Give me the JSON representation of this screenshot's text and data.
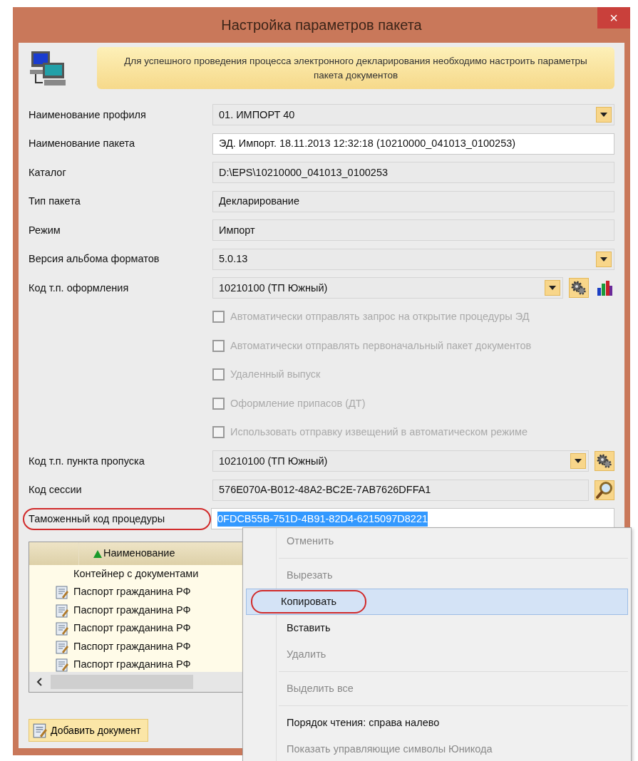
{
  "window": {
    "title": "Настройка параметров пакета",
    "close": "×"
  },
  "banner": {
    "text": "Для успешного проведения процесса электронного декларирования необходимо настроить параметры пакета документов"
  },
  "rows": [
    {
      "kind": "combo",
      "label": "Наименование профиля",
      "value": "01. ИМПОРТ 40",
      "readonly": true,
      "buttons": []
    },
    {
      "kind": "text",
      "label": "Наименование пакета",
      "value": "ЭД. Импорт. 18.11.2013 12:32:18 (10210000_041013_0100253)",
      "readonly": false,
      "buttons": []
    },
    {
      "kind": "text",
      "label": "Каталог",
      "value": "D:\\EPS\\10210000_041013_0100253",
      "readonly": true,
      "buttons": []
    },
    {
      "kind": "text",
      "label": "Тип пакета",
      "value": "Декларирование",
      "readonly": true,
      "buttons": []
    },
    {
      "kind": "text",
      "label": "Режим",
      "value": "Импорт",
      "readonly": true,
      "buttons": []
    },
    {
      "kind": "combo",
      "label": "Версия альбома форматов",
      "value": "5.0.13",
      "readonly": true,
      "buttons": []
    },
    {
      "kind": "combo",
      "label": "Код т.п. оформления",
      "value": "10210100 (ТП Южный)",
      "readonly": true,
      "buttons": [
        {
          "kind": "gear"
        },
        {
          "kind": "chart"
        }
      ]
    },
    {
      "kind": "checkbox",
      "label": "Автоматически отправлять запрос на открытие процедуры ЭД",
      "checked": false,
      "disabled": true
    },
    {
      "kind": "checkbox",
      "label": "Автоматически отправлять первоначальный пакет документов",
      "checked": false,
      "disabled": true
    },
    {
      "kind": "checkbox",
      "label": "Удаленный выпуск",
      "checked": false,
      "disabled": true
    },
    {
      "kind": "checkbox",
      "label": "Оформление припасов (ДТ)",
      "checked": false,
      "disabled": true
    },
    {
      "kind": "checkbox",
      "label": "Использовать отправку извещений в автоматическом режиме",
      "checked": false,
      "disabled": true
    },
    {
      "kind": "combo",
      "label": "Код т.п. пункта пропуска",
      "value": "10210100 (ТП Южный)",
      "readonly": true,
      "buttons": [
        {
          "kind": "gear"
        }
      ]
    },
    {
      "kind": "text",
      "label": "Код сессии",
      "value": "576E070A-B012-48A2-BC2E-7AB7626DFFA1",
      "readonly": true,
      "buttons": [
        {
          "kind": "search"
        }
      ]
    },
    {
      "kind": "text",
      "label": "Таможенный код процедуры",
      "value": "0FDCB55B-751D-4B91-82D4-6215097D8221",
      "readonly": false,
      "selected": true,
      "highlighted": true,
      "buttons": []
    }
  ],
  "table": {
    "columns": [
      {
        "label": "Наименование",
        "sort_ascending": true
      }
    ],
    "rows": [
      {
        "kind": "container",
        "name": "Контейнер с документами"
      },
      {
        "kind": "document",
        "name": "Паспорт гражданина РФ"
      },
      {
        "kind": "document",
        "name": "Паспорт гражданина РФ"
      },
      {
        "kind": "document",
        "name": "Паспорт гражданина РФ"
      },
      {
        "kind": "document",
        "name": "Паспорт гражданина РФ"
      },
      {
        "kind": "document",
        "name": "Паспорт гражданина РФ"
      }
    ]
  },
  "add_button": {
    "label": "Добавить документ"
  },
  "context_menu": [
    {
      "kind": "item",
      "label": "Отменить",
      "disabled": true,
      "selected": false,
      "highlighted": false
    },
    {
      "kind": "separator"
    },
    {
      "kind": "item",
      "label": "Вырезать",
      "disabled": true,
      "selected": false,
      "highlighted": false
    },
    {
      "kind": "item",
      "label": "Копировать",
      "disabled": false,
      "selected": true,
      "highlighted": true
    },
    {
      "kind": "item",
      "label": "Вставить",
      "disabled": false,
      "selected": false,
      "highlighted": false
    },
    {
      "kind": "item",
      "label": "Удалить",
      "disabled": true,
      "selected": false,
      "highlighted": false
    },
    {
      "kind": "separator"
    },
    {
      "kind": "item",
      "label": "Выделить все",
      "disabled": true,
      "selected": false,
      "highlighted": false
    },
    {
      "kind": "separator"
    },
    {
      "kind": "item",
      "label": "Порядок чтения: справа налево",
      "disabled": false,
      "selected": false,
      "highlighted": false
    },
    {
      "kind": "item",
      "label": "Показать управляющие символы Юникода",
      "disabled": true,
      "selected": false,
      "highlighted": false
    }
  ]
}
